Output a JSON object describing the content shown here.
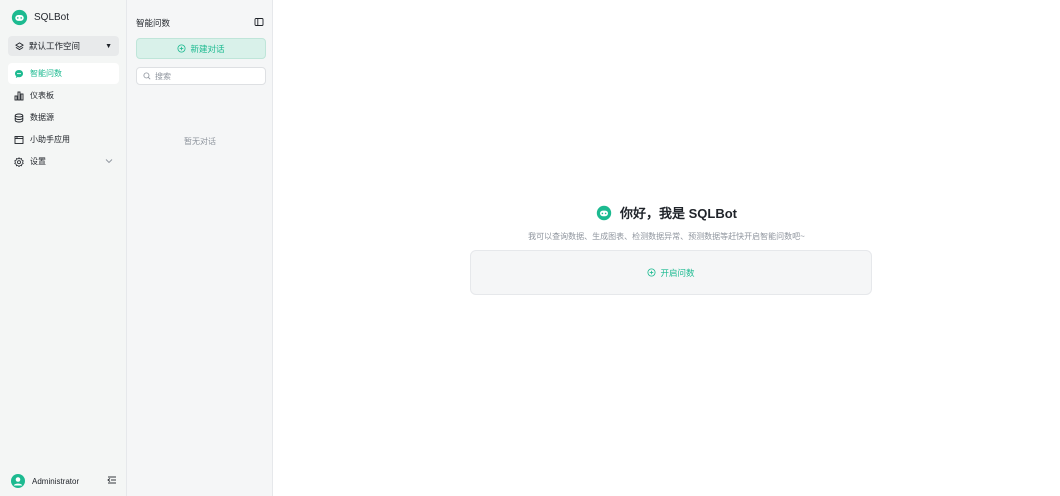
{
  "app": {
    "name": "SQLBot"
  },
  "workspace": {
    "name": "默认工作空间"
  },
  "nav": [
    {
      "label": "智能问数",
      "icon": "chat-bubble-icon",
      "active": true
    },
    {
      "label": "仪表板",
      "icon": "dashboard-icon"
    },
    {
      "label": "数据源",
      "icon": "database-icon"
    },
    {
      "label": "小助手应用",
      "icon": "app-window-icon"
    },
    {
      "label": "设置",
      "icon": "settings-icon"
    }
  ],
  "user": {
    "name": "Administrator"
  },
  "chatlist": {
    "title": "智能问数",
    "new_chat_label": "新建对话",
    "search_placeholder": "搜索",
    "empty_text": "暂无对话"
  },
  "main": {
    "greeting": "你好，我是 SQLBot",
    "subtitle": "我可以查询数据、生成图表、检测数据异常、预测数据等赶快开启智能问数吧~",
    "start_label": "开启问数"
  },
  "colors": {
    "accent": "#1cba90",
    "sidebar_bg": "#f4f6f5",
    "muted": "#8f959e"
  }
}
